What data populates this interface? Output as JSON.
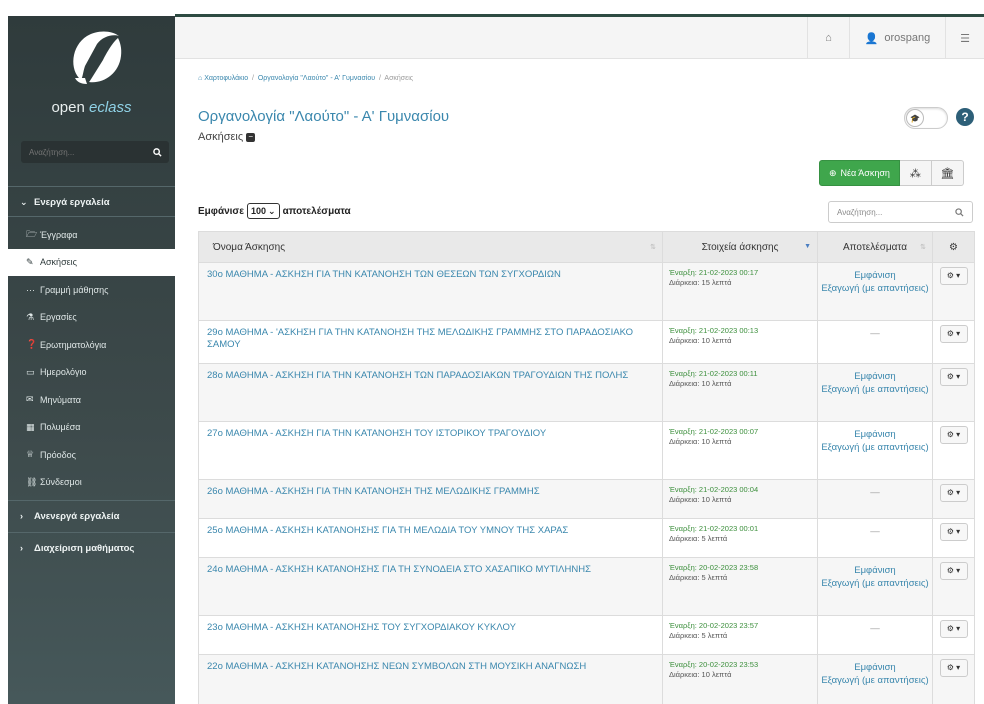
{
  "sidebar": {
    "logo_text_a": "open ",
    "logo_text_b": "eclass",
    "search_placeholder": "Αναζήτηση...",
    "active_tools_label": "Ενεργά εργαλεία",
    "items": [
      {
        "label": "Έγγραφα",
        "icon": "folder-icon",
        "glyph": "🗁"
      },
      {
        "label": "Ασκήσεις",
        "icon": "edit-icon",
        "glyph": "✎"
      },
      {
        "label": "Γραμμή μάθησης",
        "icon": "ellipsis-icon",
        "glyph": "···"
      },
      {
        "label": "Εργασίες",
        "icon": "flask-icon",
        "glyph": "⚗"
      },
      {
        "label": "Ερωτηματολόγια",
        "icon": "question-icon",
        "glyph": "❓"
      },
      {
        "label": "Ημερολόγιο",
        "icon": "calendar-icon",
        "glyph": "▭"
      },
      {
        "label": "Μηνύματα",
        "icon": "envelope-icon",
        "glyph": "✉"
      },
      {
        "label": "Πολυμέσα",
        "icon": "film-icon",
        "glyph": "▦"
      },
      {
        "label": "Πρόοδος",
        "icon": "trophy-icon",
        "glyph": "♕"
      },
      {
        "label": "Σύνδεσμοι",
        "icon": "link-icon",
        "glyph": "⛓"
      }
    ],
    "inactive_tools_label": "Ανενεργά εργαλεία",
    "course_admin_label": "Διαχείριση μαθήματος"
  },
  "topbar": {
    "username": "orospang"
  },
  "breadcrumb": {
    "home": "Χαρτοφυλάκιο",
    "course": "Οργανολογία \"Λαούτο\" - Α' Γυμνασίου",
    "current": "Ασκήσεις"
  },
  "page": {
    "title": "Οργανολογία \"Λαούτο\" - Α' Γυμνασίου",
    "subtitle": "Ασκήσεις",
    "new_exercise_label": "Νέα Άσκηση"
  },
  "table_controls": {
    "show_label": "Εμφάνισε",
    "page_size": "100",
    "results_label": "αποτελέσματα",
    "search_placeholder": "Αναζήτηση..."
  },
  "table": {
    "headers": {
      "name": "Όνομα Άσκησης",
      "info": "Στοιχεία άσκησης",
      "results": "Αποτελέσματα"
    },
    "result_labels": {
      "show": "Εμφάνιση",
      "export": "Εξαγωγή (με απαντήσεις)",
      "none": "—"
    },
    "rows": [
      {
        "name": "30ο ΜΑΘΗΜΑ - ΑΣΚΗΣΗ ΓΙΑ ΤΗΝ ΚΑΤΑΝΟΗΣΗ ΤΩΝ ΘΕΣΕΩΝ ΤΩΝ ΣΥΓΧΟΡΔΙΩΝ",
        "start": "Έναρξη: 21-02-2023 00:17",
        "duration": "Διάρκεια: 15 λεπτά",
        "has_results": true
      },
      {
        "name": "29ο ΜΑΘΗΜΑ - 'ΑΣΚΗΣΗ ΓΙΑ ΤΗΝ ΚΑΤΑΝΟΗΣΗ ΤΗΣ ΜΕΛΩΔΙΚΗΣ ΓΡΑΜΜΗΣ ΣΤΟ ΠΑΡΑΔΟΣΙΑΚΟ ΣΑΜΟΥ",
        "start": "Έναρξη: 21-02-2023 00:13",
        "duration": "Διάρκεια: 10 λεπτά",
        "has_results": false
      },
      {
        "name": "28ο ΜΑΘΗΜΑ - ΑΣΚΗΣΗ ΓΙΑ ΤΗΝ ΚΑΤΑΝΟΗΣΗ ΤΩΝ ΠΑΡΑΔΟΣΙΑΚΩΝ ΤΡΑΓΟΥΔΙΩΝ ΤΗΣ ΠΟΛΗΣ",
        "start": "Έναρξη: 21-02-2023 00:11",
        "duration": "Διάρκεια: 10 λεπτά",
        "has_results": true
      },
      {
        "name": "27ο ΜΑΘΗΜΑ - ΑΣΚΗΣΗ ΓΙΑ ΤΗΝ ΚΑΤΑΝΟΗΣΗ ΤΟΥ ΙΣΤΟΡΙΚΟΥ ΤΡΑΓΟΥΔΙΟΥ",
        "start": "Έναρξη: 21-02-2023 00:07",
        "duration": "Διάρκεια: 10 λεπτά",
        "has_results": true
      },
      {
        "name": "26ο ΜΑΘΗΜΑ - ΑΣΚΗΣΗ ΓΙΑ ΤΗΝ ΚΑΤΑΝΟΗΣΗ ΤΗΣ ΜΕΛΩΔΙΚΗΣ ΓΡΑΜΜΗΣ",
        "start": "Έναρξη: 21-02-2023 00:04",
        "duration": "Διάρκεια: 10 λεπτά",
        "has_results": false
      },
      {
        "name": "25ο ΜΑΘΗΜΑ - ΑΣΚΗΣΗ ΚΑΤΑΝΟΗΣΗΣ ΓΙΑ ΤΗ ΜΕΛΩΔΙΑ ΤΟΥ ΥΜΝΟΥ ΤΗΣ ΧΑΡΑΣ",
        "start": "Έναρξη: 21-02-2023 00:01",
        "duration": "Διάρκεια: 5 λεπτά",
        "has_results": false
      },
      {
        "name": "24ο ΜΑΘΗΜΑ - ΑΣΚΗΣΗ ΚΑΤΑΝΟΗΣΗΣ ΓΙΑ ΤΗ ΣΥΝΟΔΕΙΑ ΣΤΟ ΧΑΣΑΠΙΚΟ ΜΥΤΙΛΗΝΗΣ",
        "start": "Έναρξη: 20-02-2023 23:58",
        "duration": "Διάρκεια: 5 λεπτά",
        "has_results": true
      },
      {
        "name": "23ο ΜΑΘΗΜΑ - ΑΣΚΗΣΗ ΚΑΤΑΝΟΗΣΗΣ ΤΟΥ ΣΥΓΧΟΡΔΙΑΚΟΥ ΚΥΚΛΟΥ",
        "start": "Έναρξη: 20-02-2023 23:57",
        "duration": "Διάρκεια: 5 λεπτά",
        "has_results": false
      },
      {
        "name": "22ο ΜΑΘΗΜΑ - ΑΣΚΗΣΗ ΚΑΤΑΝΟΗΣΗΣ ΝΕΩΝ ΣΥΜΒΟΛΩΝ ΣΤΗ ΜΟΥΣΙΚΗ ΑΝΑΓΝΩΣΗ",
        "start": "Έναρξη: 20-02-2023 23:53",
        "duration": "Διάρκεια: 10 λεπτά",
        "has_results": true
      }
    ]
  }
}
